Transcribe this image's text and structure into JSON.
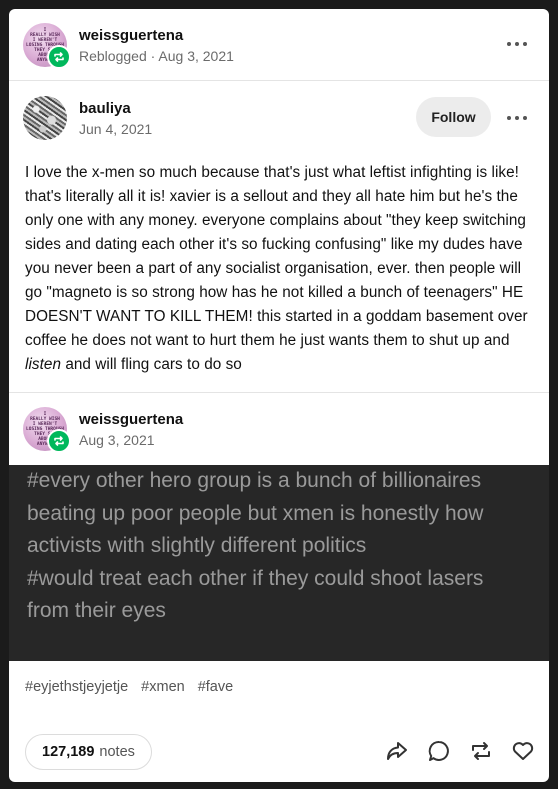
{
  "reblog_header": {
    "username": "weissguertena",
    "action": "Reblogged",
    "date": "Aug 3, 2021",
    "avatar_text": [
      "I",
      "REALLY WISH",
      "I WEREN'T",
      "LOSING THROUGH",
      "THEY SAY",
      "ABOUT",
      "ANYWAY"
    ]
  },
  "original_post": {
    "username": "bauliya",
    "date": "Jun 4, 2021",
    "follow_label": "Follow",
    "body_before": "I love the x-men so much because that's just what leftist infighting is like! that's literally all it is! xavier is a sellout and they all hate him but he's the only one with any money. everyone complains about \"they keep switching sides and dating each other it's so fucking confusing\" like my dudes have you never been a part of any socialist organisation, ever. then people will go \"magneto is so strong how has he not killed a bunch of teenagers\" HE DOESN'T WANT TO KILL THEM! this started in a goddam basement over coffee he does not want to hurt them he just wants them to shut up and ",
    "body_italic": "listen",
    "body_after": " and will fling cars to do so"
  },
  "reblog": {
    "username": "weissguertena",
    "date": "Aug 3, 2021",
    "inline_tags": [
      "#every other hero group is a bunch of billionaires beating up poor people but xmen is honestly how activists with slightly different politics",
      "#would treat each other if they could shoot lasers from their eyes"
    ]
  },
  "tags": [
    "#eyjethstjeyjetje",
    "#xmen",
    "#fave"
  ],
  "footer": {
    "notes_count": "127,189",
    "notes_label": "notes",
    "actions": [
      "share-icon",
      "reply-icon",
      "reblog-icon",
      "like-icon"
    ]
  },
  "colors": {
    "reblog_badge": "#00b85c",
    "dark_panel": "#272727",
    "page_bg": "#1b1b1b"
  }
}
